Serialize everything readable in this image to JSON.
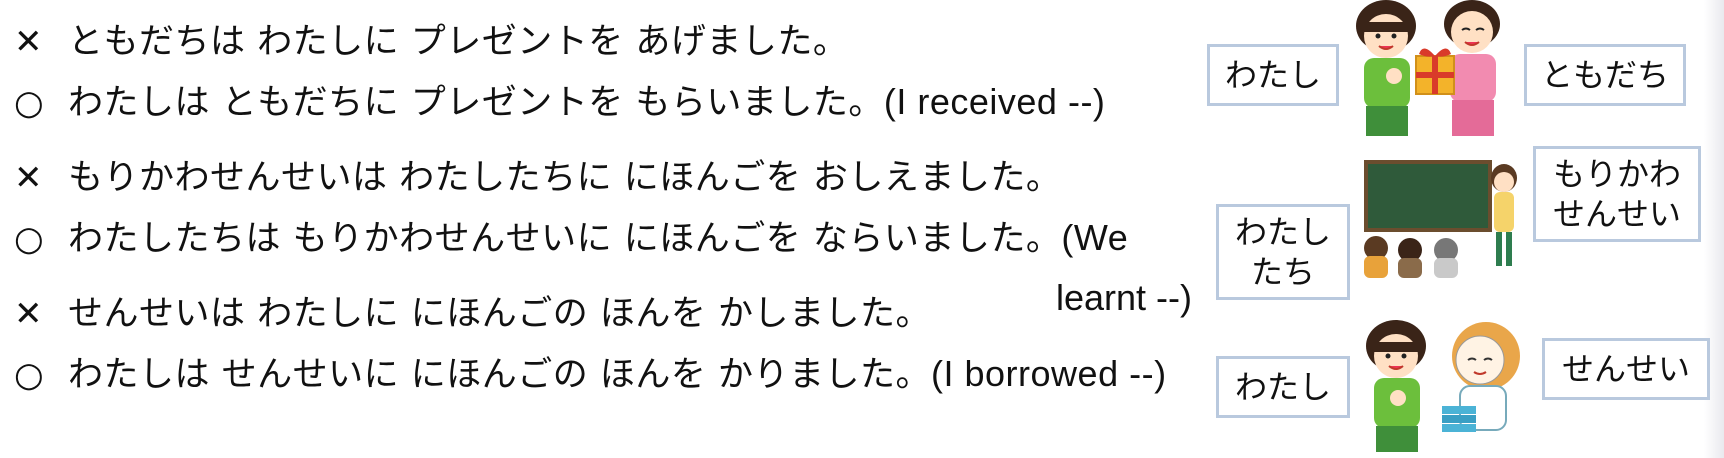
{
  "sentences": [
    {
      "mark": "✕",
      "text": "ともだちは わたしに プレゼントを あげました。",
      "english": ""
    },
    {
      "mark": "○",
      "text": "わたしは ともだちに プレゼントを もらいました。",
      "english": "(I received --)"
    },
    {
      "mark": "✕",
      "text": "もりかわせんせいは わたしたちに にほんごを おしえました。",
      "english": ""
    },
    {
      "mark": "○",
      "text": "わたしたちは もりかわせんせいに にほんごを ならいました。",
      "english": "(We"
    },
    {
      "mark": "✕",
      "text": "せんせいは わたしに にほんごの ほんを かしました。",
      "english": ""
    },
    {
      "mark": "○",
      "text": "わたしは せんせいに にほんごの ほんを かりました。",
      "english": "(I borrowed --)"
    }
  ],
  "continuation": "learnt --)",
  "labels": {
    "row1_left": "わたし",
    "row1_right": "ともだち",
    "row2_left": "わたし\nたち",
    "row2_right": "もりかわ\nせんせい",
    "row3_left": "わたし",
    "row3_right": "せんせい"
  },
  "illustrations": {
    "row1": "girl-receiving-gift-from-friend-icon",
    "row2": "teacher-at-blackboard-with-students-icon",
    "row3": "girl-and-teacher-with-books-icon"
  },
  "colors": {
    "box_border": "#b9c9de",
    "blackboard": "#2f5a3a",
    "gift": "#f3b32a"
  }
}
